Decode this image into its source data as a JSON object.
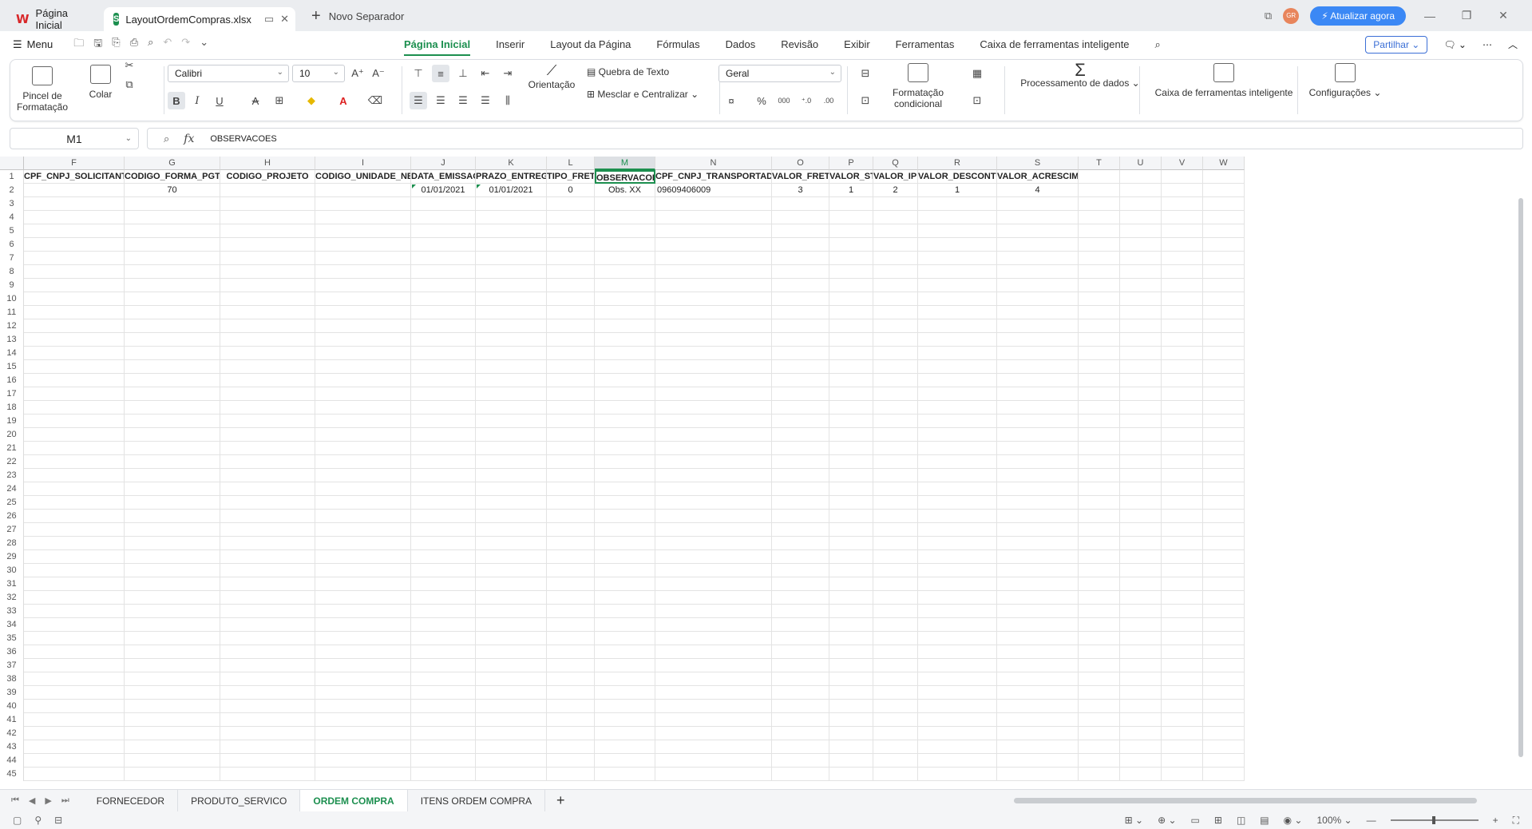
{
  "titlebar": {
    "home_tab": "Página Inicial",
    "file_tab": "LayoutOrdemCompras.xlsx",
    "new_tab": "Novo Separador",
    "avatar": "GR",
    "upgrade": "⚡ Atualizar agora"
  },
  "menubar": {
    "menu_label": "Menu",
    "tabs": [
      "Página Inicial",
      "Inserir",
      "Layout da Página",
      "Fórmulas",
      "Dados",
      "Revisão",
      "Exibir",
      "Ferramentas",
      "Caixa de ferramentas inteligente"
    ],
    "share": "Partilhar"
  },
  "ribbon": {
    "format_painter": "Pincel de Formatação",
    "paste": "Colar",
    "font_name": "Calibri",
    "font_size": "10",
    "wrap_text": "Quebra de Texto",
    "orientation": "Orientação",
    "merge_center": "Mesclar e Centralizar",
    "number_format": "Geral",
    "conditional_formatting": "Formatação condicional",
    "data_processing": "Processamento de dados",
    "smart_toolbox": "Caixa de ferramentas inteligente",
    "settings": "Configurações"
  },
  "formula_bar": {
    "name_box": "M1",
    "formula": "OBSERVACOES"
  },
  "grid": {
    "columns": [
      "F",
      "G",
      "H",
      "I",
      "J",
      "K",
      "L",
      "M",
      "N",
      "O",
      "P",
      "Q",
      "R",
      "S",
      "T",
      "U",
      "V",
      "W"
    ],
    "row_count": 45,
    "header_row": [
      "CPF_CNPJ_SOLICITANTE",
      "CODIGO_FORMA_PGTO",
      "CODIGO_PROJETO",
      "CODIGO_UNIDADE_NEGOCIO",
      "DATA_EMISSAO",
      "PRAZO_ENTREGA",
      "TIPO_FRETE",
      "OBSERVACOES",
      "CPF_CNPJ_TRANSPORTADOR",
      "VALOR_FRETE",
      "VALOR_ST",
      "VALOR_IPI",
      "VALOR_DESCONTO",
      "VALOR_ACRESCIMO",
      "",
      "",
      "",
      ""
    ],
    "data_row": [
      "",
      "70",
      "",
      "",
      "01/01/2021",
      "01/01/2021",
      "0",
      "Obs. XX",
      "09609406009",
      "3",
      "1",
      "2",
      "1",
      "4",
      "",
      "",
      "",
      ""
    ],
    "selected_column": "M"
  },
  "sheets": {
    "tabs": [
      "FORNECEDOR",
      "PRODUTO_SERVICO",
      "ORDEM COMPRA",
      "ITENS ORDEM COMPRA"
    ],
    "active": "ORDEM COMPRA"
  },
  "statusbar": {
    "zoom": "100%"
  }
}
